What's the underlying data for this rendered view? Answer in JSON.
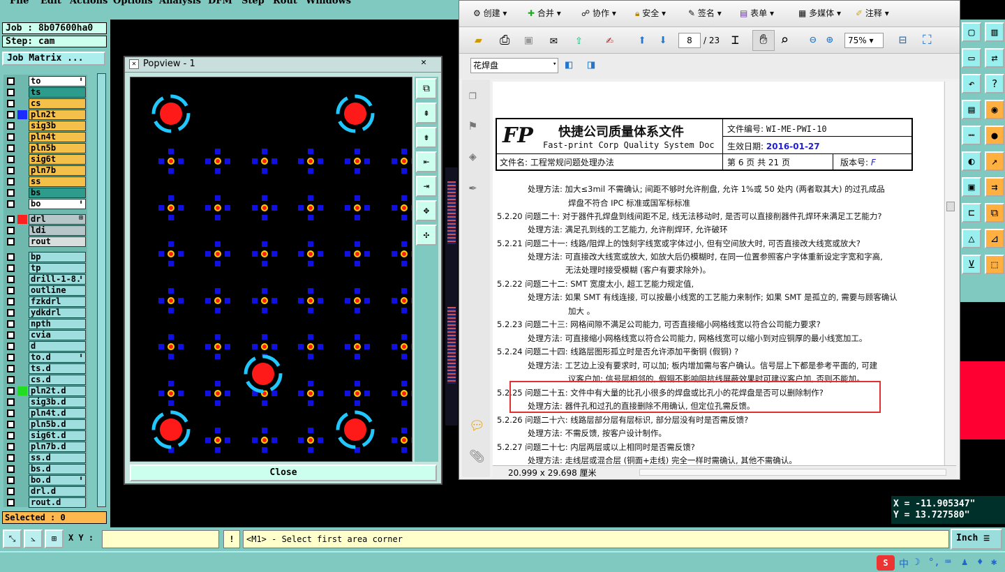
{
  "menu": {
    "items": [
      "File",
      "Edit",
      "Actions",
      "Options",
      "Analysis",
      "DFM",
      "Step",
      "Rout",
      "Windows"
    ]
  },
  "job": {
    "job_line": "Job : 8b07600ha0",
    "step_line": "Step: cam",
    "matrix_button": "Job Matrix ..."
  },
  "layers": [
    {
      "name": "to",
      "color": "#ffffff",
      "swatch": "",
      "flag": "⬍"
    },
    {
      "name": "ts",
      "color": "#2e9c8c",
      "swatch": "",
      "flag": ""
    },
    {
      "name": "cs",
      "color": "#f5c04a",
      "swatch": "",
      "flag": ""
    },
    {
      "name": "pln2t",
      "color": "#f5c04a",
      "swatch": "#1a2cff",
      "flag": ""
    },
    {
      "name": "sig3b",
      "color": "#f5c04a",
      "swatch": "",
      "flag": ""
    },
    {
      "name": "pln4t",
      "color": "#f5c04a",
      "swatch": "",
      "flag": ""
    },
    {
      "name": "pln5b",
      "color": "#f5c04a",
      "swatch": "",
      "flag": ""
    },
    {
      "name": "sig6t",
      "color": "#f5c04a",
      "swatch": "",
      "flag": ""
    },
    {
      "name": "pln7b",
      "color": "#f5c04a",
      "swatch": "",
      "flag": ""
    },
    {
      "name": "ss",
      "color": "#f5c04a",
      "swatch": "",
      "flag": ""
    },
    {
      "name": "bs",
      "color": "#2e9c8c",
      "swatch": "",
      "flag": ""
    },
    {
      "name": "bo",
      "color": "#ffffff",
      "swatch": "",
      "flag": "⬍"
    },
    {
      "name": "drl",
      "color": "#b7c7c9",
      "swatch": "#ff2020",
      "flag": "⊞"
    },
    {
      "name": "ldi",
      "color": "#b7c7c9",
      "swatch": "",
      "flag": ""
    },
    {
      "name": "rout",
      "color": "#d8dddd",
      "swatch": "",
      "flag": ""
    },
    {
      "name": "bp",
      "color": "#9fdede",
      "swatch": "",
      "flag": ""
    },
    {
      "name": "tp",
      "color": "#9fdede",
      "swatch": "",
      "flag": ""
    },
    {
      "name": "drill-1-8.",
      "color": "#9fdede",
      "swatch": "",
      "flag": "⬍"
    },
    {
      "name": "outline",
      "color": "#9fdede",
      "swatch": "",
      "flag": ""
    },
    {
      "name": "fzkdrl",
      "color": "#9fdede",
      "swatch": "",
      "flag": ""
    },
    {
      "name": "ydkdrl",
      "color": "#9fdede",
      "swatch": "",
      "flag": ""
    },
    {
      "name": "npth",
      "color": "#9fdede",
      "swatch": "",
      "flag": ""
    },
    {
      "name": "cvia",
      "color": "#9fdede",
      "swatch": "",
      "flag": ""
    },
    {
      "name": "d",
      "color": "#9fdede",
      "swatch": "",
      "flag": ""
    },
    {
      "name": "to.d",
      "color": "#9fdede",
      "swatch": "",
      "flag": "⬍"
    },
    {
      "name": "ts.d",
      "color": "#9fdede",
      "swatch": "",
      "flag": ""
    },
    {
      "name": "cs.d",
      "color": "#9fdede",
      "swatch": "",
      "flag": ""
    },
    {
      "name": "pln2t.d",
      "color": "#9fdede",
      "swatch": "#22dd22",
      "flag": ""
    },
    {
      "name": "sig3b.d",
      "color": "#9fdede",
      "swatch": "",
      "flag": ""
    },
    {
      "name": "pln4t.d",
      "color": "#9fdede",
      "swatch": "",
      "flag": ""
    },
    {
      "name": "pln5b.d",
      "color": "#9fdede",
      "swatch": "",
      "flag": ""
    },
    {
      "name": "sig6t.d",
      "color": "#9fdede",
      "swatch": "",
      "flag": ""
    },
    {
      "name": "pln7b.d",
      "color": "#9fdede",
      "swatch": "",
      "flag": ""
    },
    {
      "name": "ss.d",
      "color": "#9fdede",
      "swatch": "",
      "flag": ""
    },
    {
      "name": "bs.d",
      "color": "#9fdede",
      "swatch": "",
      "flag": ""
    },
    {
      "name": "bo.d",
      "color": "#9fdede",
      "swatch": "",
      "flag": "⬍"
    },
    {
      "name": "drl.d",
      "color": "#9fdede",
      "swatch": "",
      "flag": ""
    },
    {
      "name": "rout.d",
      "color": "#9fdede",
      "swatch": "",
      "flag": ""
    }
  ],
  "selected": "Selected : 0",
  "popview": {
    "title": "Popview - 1",
    "close_x": "✕",
    "close_button": "Close"
  },
  "pdf": {
    "toolbar1": [
      "创建",
      "合并",
      "协作",
      "安全",
      "签名",
      "表单",
      "多媒体",
      "注释"
    ],
    "page_num": "8",
    "page_total": "/ 23",
    "zoom": "75%",
    "search_value": "花焊盘",
    "status_size": "20.999 x 29.698 厘米",
    "header": {
      "company_cn": "快捷公司质量体系文件",
      "company_en": "Fast-print Corp Quality System Doc",
      "docno_label": "文件编号:",
      "docno_value": "WI-ME-PWI-10",
      "date_label": "生效日期:",
      "date_value": "2016-01-27",
      "filename": "文件名: 工程常规问题处理办法",
      "page_info": "第 6 页 共 21 页",
      "version_label": "版本号:",
      "version_value": "F"
    },
    "lines": [
      "处理方法: 加大≤3mil 不需确认; 间距不够时允许削盘, 允许 1%或 50 处内 (两者取其大) 的过孔成品",
      "焊盘不符合 IPC 标准或国军标标准",
      "5.2.20  问题二十: 对于器件孔焊盘到线间距不足, 线无法移动时, 是否可以直接削器件孔焊环来满足工艺能力?",
      "处理方法: 满足孔到线的工艺能力, 允许削焊环, 允许破环",
      "5.2.21  问题二十一: 线路/阻焊上的蚀刻字线宽或字体过小, 但有空间放大时, 可否直接改大线宽或放大?",
      "处理方法: 可直接改大线宽或放大, 如放大后仍模糊时, 在同一位置参照客户字体重新设定字宽和字高,",
      "无法处理时接受模糊 (客户有要求除外)。",
      "5.2.22  问题二十二: SMT 宽度太小, 超工艺能力规定值,",
      "处理方法: 如果 SMT 有线连接, 可以按最小线宽的工艺能力来制作; 如果 SMT 是孤立的, 需要与顾客确认",
      "加大 。",
      "5.2.23  问题二十三: 网格间隙不满足公司能力, 可否直接缩小网格线宽以符合公司能力要求?",
      "处理方法: 可直接缩小网格线宽以符合公司能力, 网格线宽可以缩小到对应铜厚的最小线宽加工。",
      "5.2.24  问题二十四: 线路层图形孤立时是否允许添加平衡铜 (假铜) ?",
      "处理方法: 工艺边上没有要求时, 可以加; 板内增加需与客户确认。信号层上下都是参考平面的, 可建",
      "议客户加; 信号层相邻的, 假铜不影响阻抗线屏蔽效果时可建议客户加, 否则不能加。",
      "5.2.25  问题二十五: 文件中有大量的比孔小很多的焊盘或比孔小的花焊盘是否可以删除制作?",
      "处理方法: 器件孔和过孔的直接删除不用确认, 但定位孔需反馈。",
      "5.2.26  问题二十六: 线路层部分层有层标识, 部分层没有时是否需反馈?",
      "处理方法: 不需反馈, 按客户设计制作。",
      "5.2.27  问题二十七: 内层两层或以上相同时是否需反馈?",
      "处理方法: 走线层或混合层 (铜面+走线) 完全一样时需确认, 其他不需确认。"
    ]
  },
  "coords": {
    "x": "X = -11.905347\"",
    "y": "Y = 13.727580\""
  },
  "cmd": {
    "xy_label": "X Y :",
    "xy_value": "",
    "message": "<M1> - Select first area corner",
    "unit": "Inch"
  }
}
